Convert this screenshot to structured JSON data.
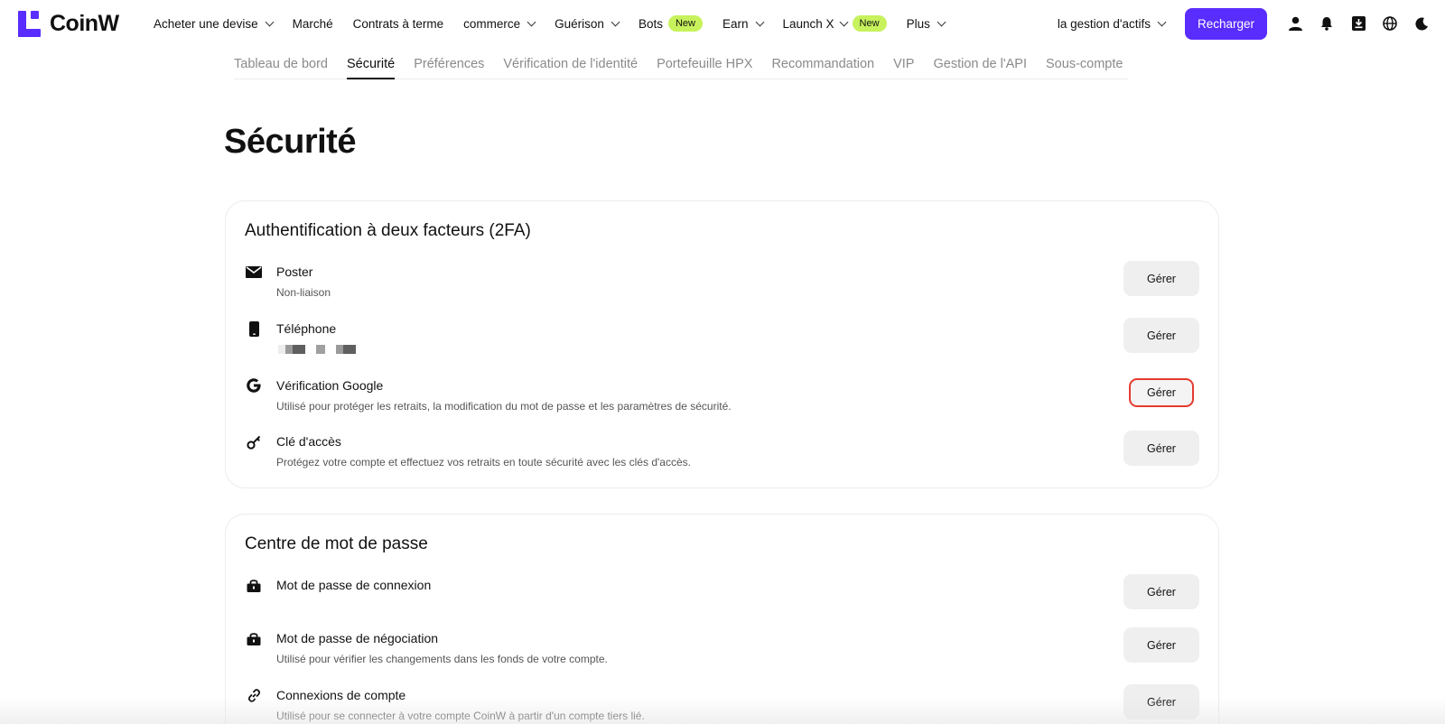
{
  "brand": {
    "name": "CoinW",
    "accent": "#5a2dff",
    "badge_color": "#c7f25c"
  },
  "nav": {
    "items": [
      {
        "label": "Acheter une devise",
        "dropdown": true
      },
      {
        "label": "Marché",
        "dropdown": false
      },
      {
        "label": "Contrats à terme",
        "dropdown": false
      },
      {
        "label": "commerce",
        "dropdown": true
      },
      {
        "label": "Guérison",
        "dropdown": true
      },
      {
        "label": "Bots",
        "badge": "New"
      },
      {
        "label": "Earn",
        "dropdown": true
      },
      {
        "label": "Launch X",
        "dropdown": true,
        "badge": "New"
      },
      {
        "label": "Plus",
        "dropdown": true
      }
    ],
    "asset_management": "la gestion d'actifs",
    "recharge": "Recharger",
    "icons": [
      "user-icon",
      "bell-icon",
      "download-icon",
      "globe-icon",
      "moon-icon"
    ]
  },
  "subnav": {
    "items": [
      "Tableau de bord",
      "Sécurité",
      "Préférences",
      "Vérification de l'identité",
      "Portefeuille HPX",
      "Recommandation",
      "VIP",
      "Gestion de l'API",
      "Sous-compte"
    ],
    "active": "Sécurité"
  },
  "page": {
    "title": "Sécurité"
  },
  "two_fa": {
    "title": "Authentification à deux facteurs (2FA)",
    "rows": [
      {
        "icon": "mail-icon",
        "title": "Poster",
        "subtitle": "Non-liaison",
        "button": "Gérer"
      },
      {
        "icon": "phone-icon",
        "title": "Téléphone",
        "subtitle": "",
        "button": "Gérer"
      },
      {
        "icon": "google-icon",
        "title": "Vérification Google",
        "subtitle": "Utilisé pour protéger les retraits, la modification du mot de passe et les paramètres de sécurité.",
        "button": "Gérer"
      },
      {
        "icon": "key-icon",
        "title": "Clé d'accès",
        "subtitle": "Protégez votre compte et effectuez vos retraits en toute sécurité avec les clés d'accès.",
        "button": "Gérer"
      }
    ]
  },
  "password_center": {
    "title": "Centre de mot de passe",
    "rows": [
      {
        "icon": "lock-icon",
        "title": "Mot de passe de connexion",
        "subtitle": "",
        "button": "Gérer"
      },
      {
        "icon": "lock-icon",
        "title": "Mot de passe de négociation",
        "subtitle": "Utilisé pour vérifier les changements dans les fonds de votre compte.",
        "button": "Gérer"
      },
      {
        "icon": "link-icon",
        "title": "Connexions de compte",
        "subtitle": "Utilisé pour se connecter à votre compte CoinW à partir d'un compte tiers lié.",
        "button": "Gérer"
      }
    ]
  }
}
